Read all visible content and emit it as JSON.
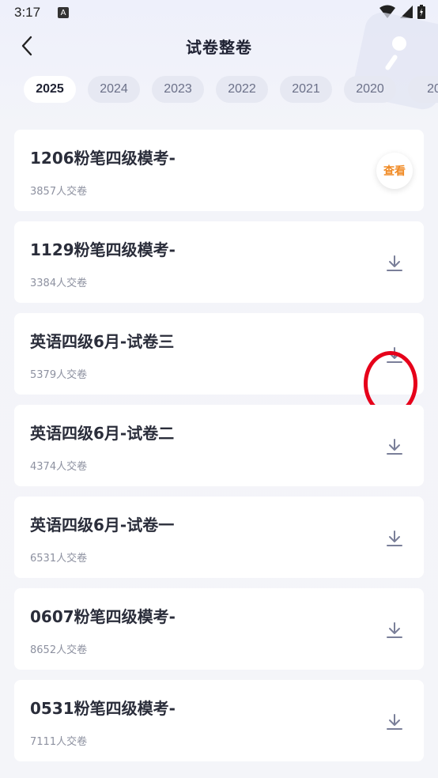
{
  "status": {
    "time": "3:17",
    "a_badge": "A"
  },
  "header": {
    "title": "试卷整卷"
  },
  "years": [
    "2025",
    "2024",
    "2023",
    "2022",
    "2021",
    "2020",
    "20"
  ],
  "active_year_index": 0,
  "papers": [
    {
      "title": "1206粉笔四级模考-",
      "count": "3857人交卷",
      "action": "view",
      "action_label": "查看"
    },
    {
      "title": "1129粉笔四级模考-",
      "count": "3384人交卷",
      "action": "download"
    },
    {
      "title": "英语四级6月-试卷三",
      "count": "5379人交卷",
      "action": "download",
      "highlighted": true
    },
    {
      "title": "英语四级6月-试卷二",
      "count": "4374人交卷",
      "action": "download"
    },
    {
      "title": "英语四级6月-试卷一",
      "count": "6531人交卷",
      "action": "download"
    },
    {
      "title": "0607粉笔四级模考-",
      "count": "8652人交卷",
      "action": "download"
    },
    {
      "title": "0531粉笔四级模考-",
      "count": "7111人交卷",
      "action": "download"
    }
  ],
  "colors": {
    "accent_orange": "#f08a24",
    "highlight_red": "#e6001a",
    "title_dark": "#1f2233"
  }
}
